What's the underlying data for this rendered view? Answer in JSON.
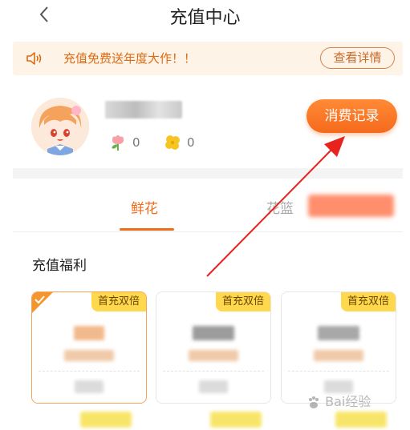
{
  "header": {
    "title": "充值中心"
  },
  "notice": {
    "text": "充值免费送年度大作！！",
    "details_label": "查看详情"
  },
  "profile": {
    "flower_count": "0",
    "clover_count": "0",
    "records_label": "消费记录"
  },
  "tabs": [
    {
      "label": "鲜花",
      "active": true
    },
    {
      "label": "花篮",
      "active": false
    }
  ],
  "section": {
    "title": "充值福利"
  },
  "cards": [
    {
      "badge": "首充双倍",
      "selected": true
    },
    {
      "badge": "首充双倍",
      "selected": false
    },
    {
      "badge": "首充双倍",
      "selected": false
    }
  ],
  "watermark": {
    "text": "Bai经验"
  },
  "colors": {
    "accent": "#f06b18",
    "notice_bg": "#fdf3e6",
    "badge_bg": "#ffd84d",
    "annotation_arrow": "#e8231e"
  }
}
